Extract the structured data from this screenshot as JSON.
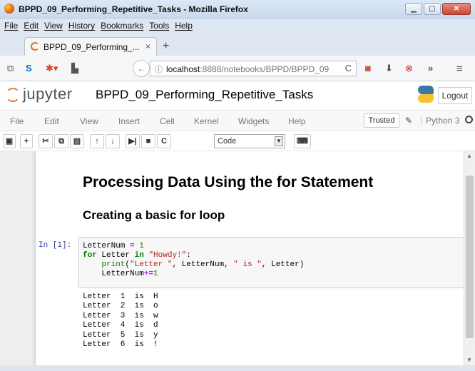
{
  "window": {
    "title": "BPPD_09_Performing_Repetitive_Tasks - Mozilla Firefox"
  },
  "menubar": [
    "File",
    "Edit",
    "View",
    "History",
    "Bookmarks",
    "Tools",
    "Help"
  ],
  "tab": {
    "label": "BPPD_09_Performing_...",
    "close": "×"
  },
  "newtab": "+",
  "address": {
    "host": "localhost",
    "rest": ":8888/notebooks/BPPD/BPPD_09"
  },
  "jupyter": {
    "logo_text": "jupyter",
    "notebook_title": "BPPD_09_Performing_Repetitive_Tasks",
    "logout": "Logout",
    "menu": [
      "File",
      "Edit",
      "View",
      "Insert",
      "Cell",
      "Kernel",
      "Widgets",
      "Help"
    ],
    "trusted": "Trusted",
    "kernel": "Python 3",
    "cell_type": "Code"
  },
  "notebook": {
    "heading1": "Processing Data Using the for Statement",
    "heading2": "Creating a basic for loop",
    "prompt": "In [1]:",
    "output_lines": [
      "Letter  1  is  H",
      "Letter  2  is  o",
      "Letter  3  is  w",
      "Letter  4  is  d",
      "Letter  5  is  y",
      "Letter  6  is  !"
    ]
  },
  "icons": [
    "firefox-logo-icon",
    "rss-icon",
    "sync-icon",
    "addon-icon",
    "library-icon",
    "back-icon",
    "info-icon",
    "reload-icon",
    "pocket-icon",
    "download-icon",
    "blocker-icon",
    "overflow-icon",
    "hamburger-icon",
    "save-icon",
    "add-cell-icon",
    "cut-icon",
    "copy-icon",
    "paste-icon",
    "move-up-icon",
    "move-down-icon",
    "run-icon",
    "stop-icon",
    "restart-icon",
    "command-palette-icon",
    "pencil-icon",
    "kernel-status-icon"
  ]
}
